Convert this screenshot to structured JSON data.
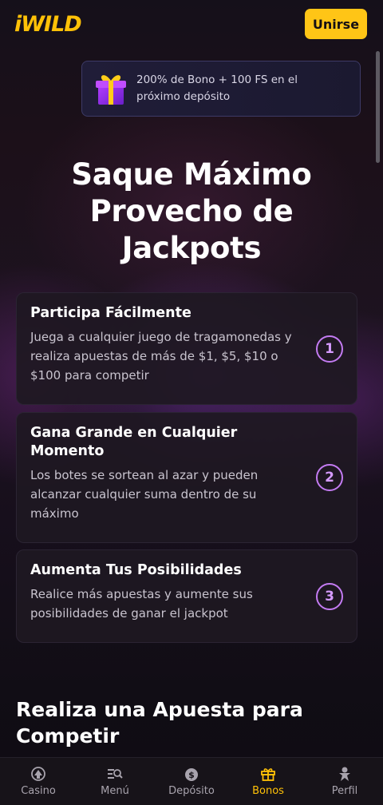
{
  "header": {
    "logo": "iWILD",
    "join_label": "Unirse"
  },
  "promo": {
    "text": "200% de Bono + 100 FS en el próximo depósito",
    "icon": "gift-icon"
  },
  "hero": {
    "title": "Saque Máximo Provecho de Jackpots"
  },
  "steps": [
    {
      "title": "Participa Fácilmente",
      "text": "Juega a cualquier juego de tragamonedas y realiza apuestas de más de $1, $5, $10 o $100 para competir",
      "number": "1"
    },
    {
      "title": "Gana Grande en Cualquier Momento",
      "text": "Los botes se sortean al azar y pueden alcanzar cualquier suma dentro de su máximo",
      "number": "2"
    },
    {
      "title": "Aumenta Tus Posibilidades",
      "text": "Realice más apuestas y aumente sus posibilidades de ganar el jackpot",
      "number": "3"
    }
  ],
  "section": {
    "title": "Realiza una Apuesta para Competir"
  },
  "nav": {
    "items": [
      {
        "label": "Casino",
        "icon": "casino-icon"
      },
      {
        "label": "Menú",
        "icon": "menu-search-icon"
      },
      {
        "label": "Depósito",
        "icon": "deposit-icon"
      },
      {
        "label": "Bonos",
        "icon": "gift-icon",
        "active": true
      },
      {
        "label": "Perfil",
        "icon": "profile-icon"
      }
    ]
  },
  "colors": {
    "accent": "#ffc516",
    "step_circle": "#c37bf2",
    "background": "#14101a"
  }
}
